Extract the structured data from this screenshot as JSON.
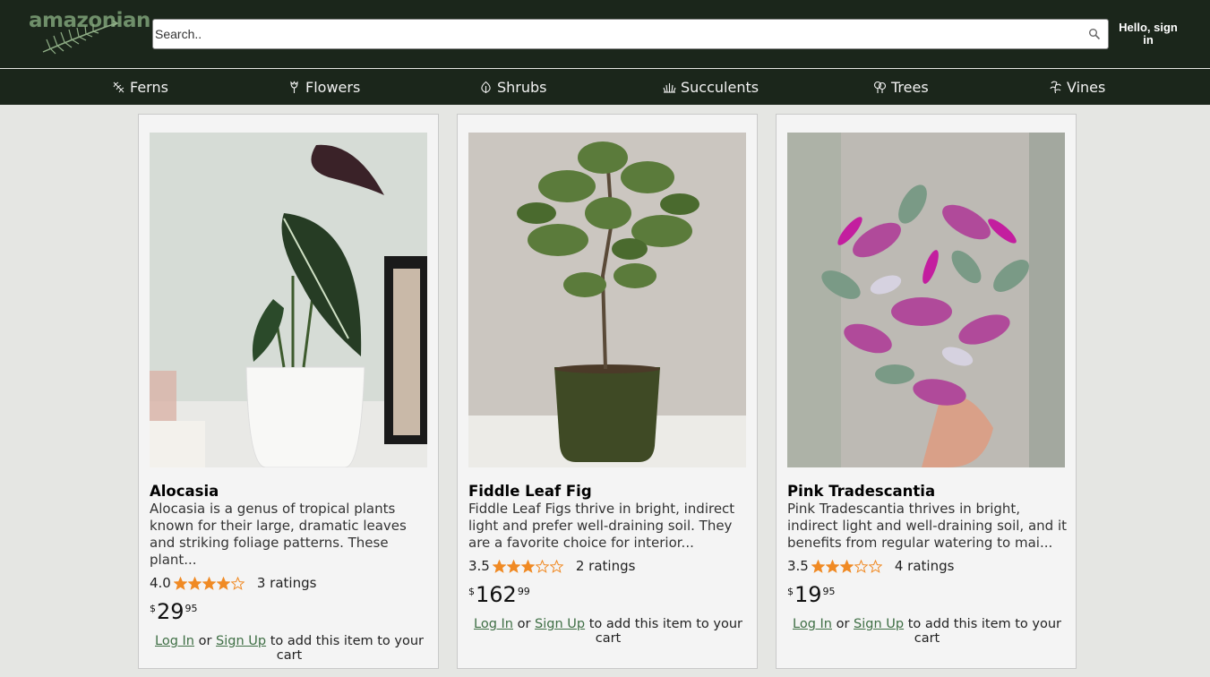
{
  "header": {
    "logo_text": "amazonian",
    "search_placeholder": "Search..",
    "signin_label": "Hello, sign in"
  },
  "categories": [
    {
      "label": "Ferns",
      "icon": "fern-icon"
    },
    {
      "label": "Flowers",
      "icon": "flower-icon"
    },
    {
      "label": "Shrubs",
      "icon": "shrub-icon"
    },
    {
      "label": "Succulents",
      "icon": "succulent-icon"
    },
    {
      "label": "Trees",
      "icon": "tree-icon"
    },
    {
      "label": "Vines",
      "icon": "vine-icon"
    }
  ],
  "products": [
    {
      "name": "Alocasia",
      "description": "Alocasia is a genus of tropical plants known for their large, dramatic leaves and striking foliage patterns. These plant...",
      "rating": "4.0",
      "rating_value": 4.0,
      "ratings_count": "3 ratings",
      "price_currency": "$",
      "price_whole": "29",
      "price_fraction": "95"
    },
    {
      "name": "Fiddle Leaf Fig",
      "description": "Fiddle Leaf Figs thrive in bright, indirect light and prefer well-draining soil. They are a favorite choice for interior...",
      "rating": "3.5",
      "rating_value": 3.5,
      "ratings_count": "2 ratings",
      "price_currency": "$",
      "price_whole": "162",
      "price_fraction": "99"
    },
    {
      "name": "Pink Tradescantia",
      "description": "Pink Tradescantia thrives in bright, indirect light and well-draining soil, and it benefits from regular watering to mai...",
      "rating": "3.5",
      "rating_value": 3.5,
      "ratings_count": "4 ratings",
      "price_currency": "$",
      "price_whole": "19",
      "price_fraction": "95"
    }
  ],
  "cta": {
    "login_label": "Log In",
    "or_text": "or",
    "signup_label": "Sign Up",
    "suffix_text": "to add this item to your cart"
  },
  "colors": {
    "header_bg": "#1b261b",
    "page_bg": "#e5e6e3",
    "star": "#f08a24",
    "link": "#3f6f45"
  }
}
